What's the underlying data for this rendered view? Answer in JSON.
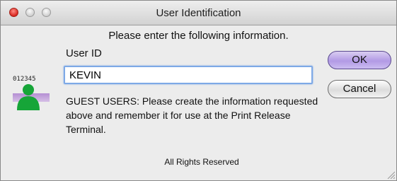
{
  "window": {
    "title": "User Identification"
  },
  "dialog": {
    "prompt": "Please enter the following information.",
    "user_id_label": "User ID",
    "user_id_value": "KEVIN",
    "guest_text": "GUEST USERS: Please create the information requested above and remember it for use at the Print Release Terminal.",
    "footer": "All Rights Reserved",
    "icon_number": "012345"
  },
  "buttons": {
    "ok": "OK",
    "cancel": "Cancel"
  },
  "colors": {
    "ok_button": "#b29ae5",
    "focus_ring": "#7ea9e6",
    "avatar": "#16a538",
    "close_button": "#d8261f"
  },
  "icons": {
    "user": "user-card-icon",
    "close": "close-icon",
    "minimize": "minimize-icon",
    "zoom": "zoom-icon",
    "resize": "resize-grip-icon"
  }
}
